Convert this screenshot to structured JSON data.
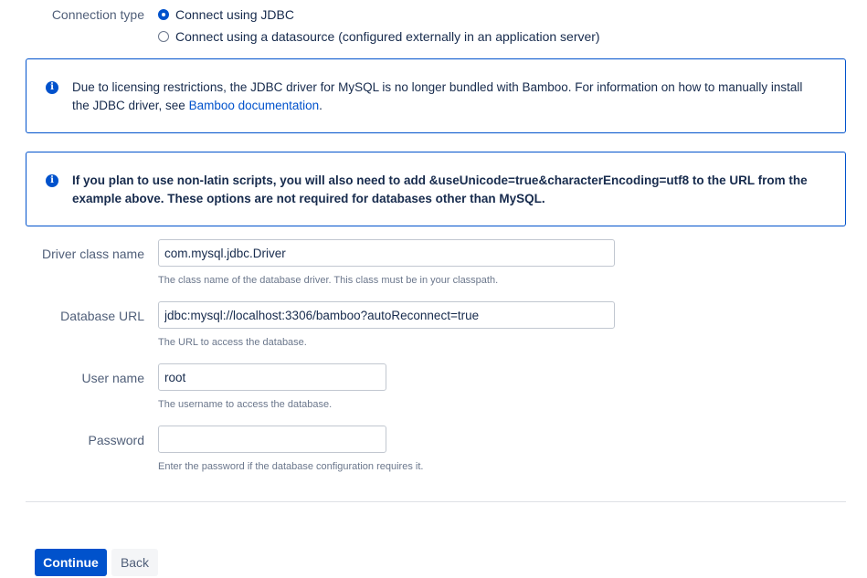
{
  "connection_type": {
    "label": "Connection type",
    "options": [
      {
        "label": "Connect using JDBC",
        "selected": true
      },
      {
        "label": "Connect using a datasource (configured externally in an application server)",
        "selected": false
      }
    ]
  },
  "info_boxes": [
    {
      "text_before": "Due to licensing restrictions, the JDBC driver for MySQL is no longer bundled with Bamboo. For information on how to manually install the JDBC driver, see ",
      "link_text": "Bamboo documentation",
      "text_after": "."
    },
    {
      "text": "If you plan to use non-latin scripts, you will also need to add &useUnicode=true&characterEncoding=utf8 to the URL from the example above. These options are not required for databases other than MySQL."
    }
  ],
  "fields": {
    "driver_class": {
      "label": "Driver class name",
      "value": "com.mysql.jdbc.Driver",
      "help": "The class name of the database driver. This class must be in your classpath."
    },
    "database_url": {
      "label": "Database URL",
      "value": "jdbc:mysql://localhost:3306/bamboo?autoReconnect=true",
      "help": "The URL to access the database."
    },
    "user_name": {
      "label": "User name",
      "value": "root",
      "help": "The username to access the database."
    },
    "password": {
      "label": "Password",
      "value": "",
      "help": "Enter the password if the database configuration requires it."
    }
  },
  "buttons": {
    "continue_label": "Continue",
    "back_label": "Back"
  },
  "colors": {
    "primary": "#0052cc",
    "label": "#505f79",
    "text": "#172b4d",
    "help": "#6b778c",
    "border": "#c1c7d0"
  },
  "icons": {
    "info": "info-icon"
  }
}
